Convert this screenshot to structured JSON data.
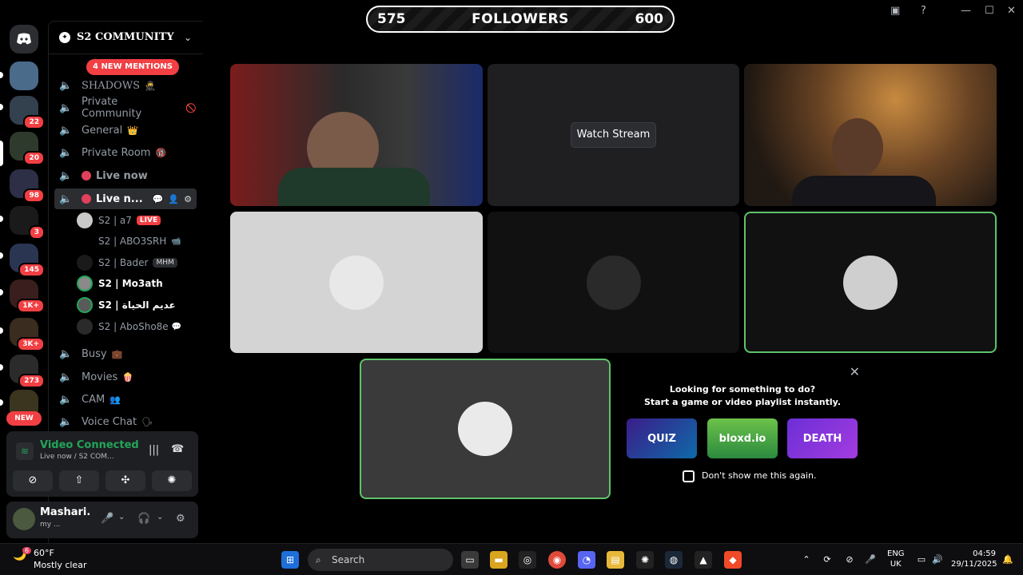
{
  "banner": {
    "left": "575",
    "center": "FOLLOWERS",
    "right": "600"
  },
  "server": {
    "name": "S2 COMMUNITY",
    "mentions": "4 NEW MENTIONS",
    "rail_badges": [
      "22",
      "20",
      "98",
      "3",
      "145",
      "1K+",
      "3K+",
      "273"
    ],
    "rail_new": "NEW"
  },
  "channels": [
    {
      "name": "SHADOWS",
      "emoji": "🥷"
    },
    {
      "name": "Private Community",
      "emoji": "🚫"
    },
    {
      "name": "General",
      "emoji": "👑"
    },
    {
      "name": "Private Room",
      "emoji": "🔞"
    },
    {
      "name": "Live now",
      "emoji": ""
    },
    {
      "name": "Live n...",
      "emoji": ""
    }
  ],
  "voice_users": [
    {
      "name": "S2 | a7",
      "tag": "LIVE"
    },
    {
      "name": "S2 | ABO3SRH",
      "tag": ""
    },
    {
      "name": "S2 | Bader",
      "tag": "MHM"
    },
    {
      "name": "S2 | Mo3ath",
      "tag": ""
    },
    {
      "name": "S2 | عديم الحياة",
      "tag": ""
    },
    {
      "name": "S2 | AboSho8e",
      "tag": ""
    }
  ],
  "channels_after": [
    {
      "name": "Busy",
      "emoji": "💼"
    },
    {
      "name": "Movies",
      "emoji": "🍿"
    },
    {
      "name": "CAM",
      "emoji": "👥"
    },
    {
      "name": "Voice Chat",
      "emoji": "🗣"
    }
  ],
  "voice_panel": {
    "status": "Video Connected",
    "channel": "Live now / S2 COM..."
  },
  "me": {
    "name": "Mashari.",
    "status": "my ..."
  },
  "stage": {
    "watch_label": "Watch Stream"
  },
  "activity": {
    "line1": "Looking for something to do?",
    "line2": "Start a game or video playlist instantly.",
    "games": [
      "QUIZ",
      "bloxd.io",
      "DEATH"
    ],
    "checkbox": "Don't show me this again."
  },
  "taskbar": {
    "temp": "60°F",
    "weather": "Mostly clear",
    "weather_badge": "6",
    "search": "Search",
    "lang1": "ENG",
    "lang2": "UK",
    "time": "04:59",
    "date": "29/11/2025"
  }
}
